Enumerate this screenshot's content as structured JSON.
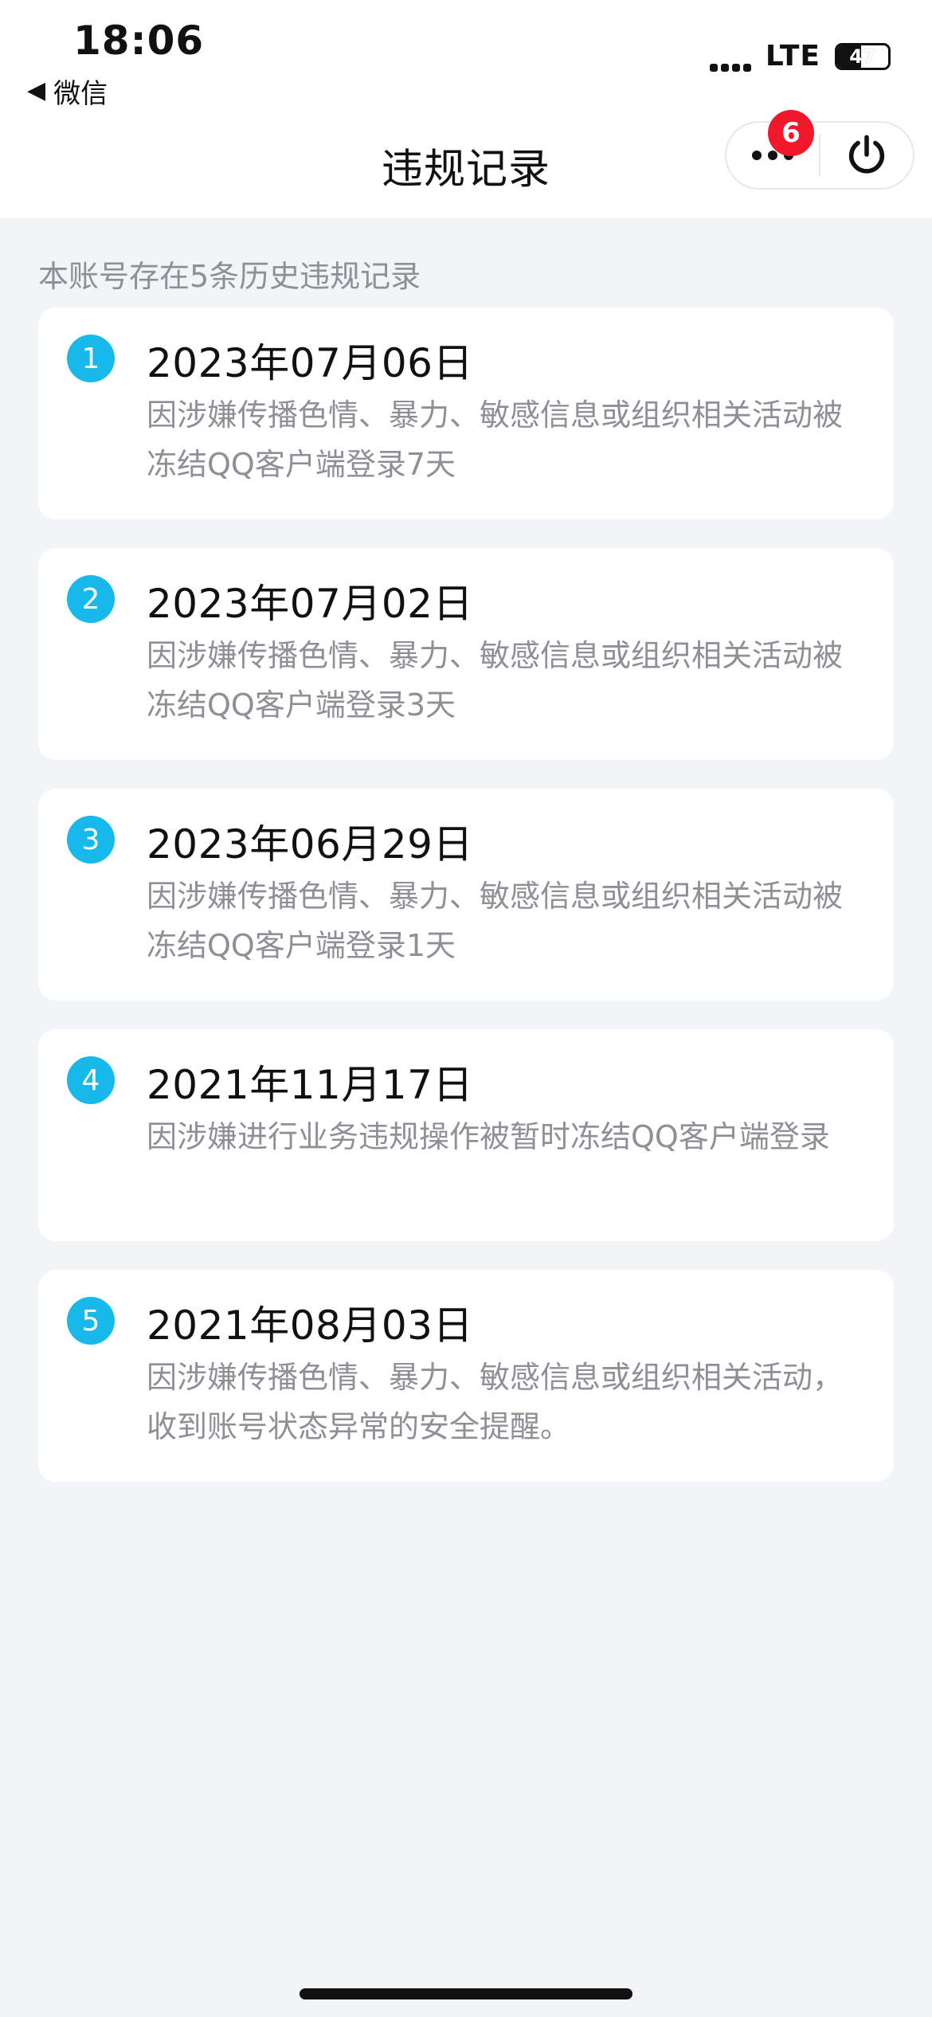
{
  "status_bar": {
    "time": "18:06",
    "back_app": "微信",
    "carrier": "LTE",
    "battery_level": 47,
    "battery_text": "47"
  },
  "header": {
    "title": "违规记录",
    "menu_badge": "6"
  },
  "summary": "本账号存在5条历史违规记录",
  "records": [
    {
      "index": "1",
      "date": "2023年07月06日",
      "description": "因涉嫌传播色情、暴力、敏感信息或组织相关活动被冻结QQ客户端登录7天"
    },
    {
      "index": "2",
      "date": "2023年07月02日",
      "description": "因涉嫌传播色情、暴力、敏感信息或组织相关活动被冻结QQ客户端登录3天"
    },
    {
      "index": "3",
      "date": "2023年06月29日",
      "description": "因涉嫌传播色情、暴力、敏感信息或组织相关活动被冻结QQ客户端登录1天"
    },
    {
      "index": "4",
      "date": "2021年11月17日",
      "description": "因涉嫌进行业务违规操作被暂时冻结QQ客户端登录"
    },
    {
      "index": "5",
      "date": "2021年08月03日",
      "description": "因涉嫌传播色情、暴力、敏感信息或组织相关活动，收到账号状态异常的安全提醒。"
    }
  ],
  "colors": {
    "accent": "#17b9ea",
    "badge": "#f1182b",
    "background": "#f3f4f8",
    "secondary_text": "#8e9096"
  },
  "icons": {
    "back": "back-caret-icon",
    "signal": "signal-bars-icon",
    "battery": "battery-icon",
    "more": "more-dots-icon",
    "power": "power-icon"
  }
}
